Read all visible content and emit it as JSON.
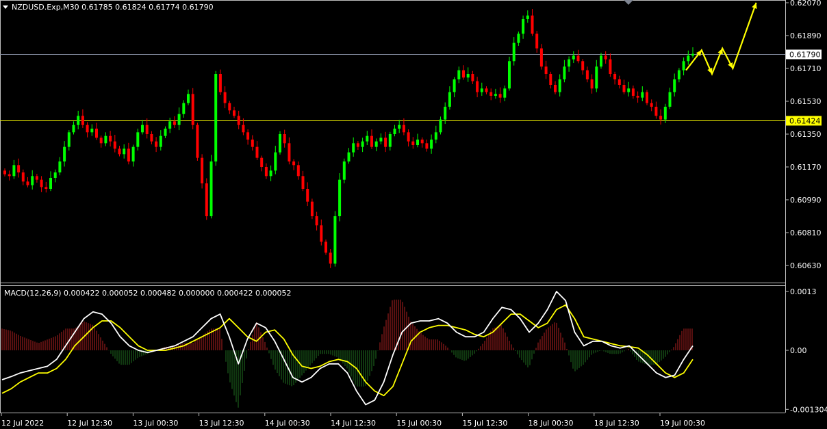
{
  "main_title": "NZDUSD.Exp,M30  0.61785 0.61824 0.61774 0.61790",
  "macd_title": "MACD(12,26,9) 0.000422 0.000052 0.000482 0.000000 0.000422 0.000052",
  "chart_data": [
    {
      "type": "candlestick",
      "symbol": "NZDUSD.Exp",
      "timeframe": "M30",
      "ohlc_last": {
        "open": 0.61785,
        "high": 0.61824,
        "low": 0.61774,
        "close": 0.6179
      },
      "ylim": [
        0.6054,
        0.6207
      ],
      "y_ticks": [
        {
          "value": 0.6207,
          "label": "0.62070"
        },
        {
          "value": 0.6189,
          "label": "0.61890"
        },
        {
          "value": 0.6171,
          "label": "0.61710"
        },
        {
          "value": 0.6153,
          "label": "0.61530"
        },
        {
          "value": 0.6135,
          "label": "0.61350"
        },
        {
          "value": 0.6117,
          "label": "0.61170"
        },
        {
          "value": 0.6099,
          "label": "0.60990"
        },
        {
          "value": 0.6081,
          "label": "0.60810"
        },
        {
          "value": 0.6063,
          "label": "0.60630"
        }
      ],
      "price_lines": [
        {
          "value": 0.6179,
          "label": "0.61790",
          "color": "#8a93a8",
          "label_bg": "#ffffff",
          "label_fg": "#000000"
        },
        {
          "value": 0.61424,
          "label": "0.61424",
          "color": "#e6e600",
          "label_bg": "#ffff00",
          "label_fg": "#000000"
        }
      ],
      "x_labels": [
        "12 Jul 2022",
        "12 Jul 12:30",
        "13 Jul 00:30",
        "13 Jul 12:30",
        "14 Jul 00:30",
        "14 Jul 12:30",
        "15 Jul 00:30",
        "15 Jul 12:30",
        "18 Jul 00:30",
        "18 Jul 12:30",
        "19 Jul 00:30"
      ],
      "bull_color": "#00ff00",
      "bear_color": "#ff0000",
      "closes": [
        0.6113,
        0.6112,
        0.6118,
        0.6114,
        0.6109,
        0.6107,
        0.6112,
        0.611,
        0.6106,
        0.6105,
        0.6111,
        0.6114,
        0.612,
        0.6128,
        0.6136,
        0.614,
        0.6145,
        0.614,
        0.6136,
        0.6138,
        0.6133,
        0.613,
        0.6134,
        0.6131,
        0.6127,
        0.6124,
        0.6127,
        0.612,
        0.6128,
        0.6136,
        0.614,
        0.6135,
        0.6131,
        0.6128,
        0.6134,
        0.6138,
        0.6142,
        0.614,
        0.6146,
        0.6152,
        0.6157,
        0.614,
        0.6122,
        0.6108,
        0.609,
        0.612,
        0.6168,
        0.6158,
        0.6152,
        0.6148,
        0.6145,
        0.614,
        0.6136,
        0.6132,
        0.6128,
        0.6122,
        0.6117,
        0.6112,
        0.6115,
        0.6125,
        0.6135,
        0.613,
        0.612,
        0.6118,
        0.6112,
        0.6105,
        0.6098,
        0.609,
        0.6085,
        0.6076,
        0.607,
        0.6064,
        0.609,
        0.611,
        0.612,
        0.6125,
        0.613,
        0.6128,
        0.6131,
        0.6134,
        0.6128,
        0.6131,
        0.6133,
        0.6128,
        0.6135,
        0.6138,
        0.614,
        0.6136,
        0.6131,
        0.6129,
        0.6132,
        0.613,
        0.6127,
        0.6132,
        0.6136,
        0.6143,
        0.615,
        0.6158,
        0.6165,
        0.617,
        0.6166,
        0.6168,
        0.6164,
        0.6158,
        0.616,
        0.6158,
        0.6156,
        0.6157,
        0.6155,
        0.616,
        0.6175,
        0.6185,
        0.619,
        0.6198,
        0.62,
        0.619,
        0.6182,
        0.6172,
        0.6168,
        0.6162,
        0.6158,
        0.6165,
        0.6172,
        0.6176,
        0.6178,
        0.6175,
        0.617,
        0.6165,
        0.616,
        0.6172,
        0.6178,
        0.6176,
        0.6168,
        0.6165,
        0.6162,
        0.6158,
        0.616,
        0.6156,
        0.6155,
        0.6158,
        0.6152,
        0.615,
        0.6145,
        0.6143,
        0.615,
        0.6158,
        0.6165,
        0.617,
        0.6175,
        0.6178,
        0.6179
      ],
      "arrows": {
        "color": "#ffff00",
        "path": [
          [
            0.617,
            0
          ],
          [
            0.6181,
            6
          ],
          [
            0.6168,
            10
          ],
          [
            0.6182,
            14
          ],
          [
            0.6171,
            18
          ],
          [
            0.6207,
            27
          ]
        ]
      }
    },
    {
      "type": "macd",
      "params": "MACD(12,26,9)",
      "ylim": [
        -0.0013,
        0.0013
      ],
      "y_ticks": [
        {
          "value": 0.0013,
          "label": "0.0013"
        },
        {
          "value": 0.0,
          "label": "0.00"
        },
        {
          "value": -0.001304,
          "label": "-0.001304"
        }
      ],
      "macd_line_color": "#ffffff",
      "signal_line_color": "#ffff00",
      "hist_pos_color": "#b02020",
      "hist_neg_color": "#207020",
      "macd": [
        -0.00065,
        -0.00058,
        -0.0005,
        -0.00045,
        -0.0004,
        -0.00035,
        -0.0002,
        0.0001,
        0.0004,
        0.0007,
        0.00085,
        0.0008,
        0.0006,
        0.0003,
        0.0001,
        0.0,
        -5e-05,
        0.0,
        5e-05,
        0.0001,
        0.0002,
        0.0003,
        0.0005,
        0.0007,
        0.0008,
        0.0003,
        -0.0003,
        0.00025,
        0.0006,
        0.0005,
        0.0002,
        -0.0002,
        -0.0006,
        -0.0007,
        -0.0006,
        -0.0004,
        -0.0003,
        -0.0003,
        -0.0005,
        -0.0009,
        -0.0012,
        -0.0011,
        -0.0007,
        -0.0001,
        0.0004,
        0.0006,
        0.00065,
        0.00065,
        0.0007,
        0.0006,
        0.0004,
        0.0003,
        0.0003,
        0.0004,
        0.0007,
        0.00095,
        0.0009,
        0.0007,
        0.0004,
        0.0006,
        0.0009,
        0.0013,
        0.0011,
        0.0004,
        0.0001,
        0.0002,
        0.0002,
        0.0001,
        5e-05,
        0.0001,
        -0.0001,
        -0.0003,
        -0.0005,
        -0.0006,
        -0.00055,
        -0.0002,
        0.0001
      ],
      "signal": [
        -0.00095,
        -0.00085,
        -0.0007,
        -0.0006,
        -0.0005,
        -0.0005,
        -0.0004,
        -0.0002,
        0.0001,
        0.0003,
        0.0005,
        0.00065,
        0.00065,
        0.0005,
        0.0003,
        0.0001,
        0.0,
        0.0,
        0.0,
        5e-05,
        0.0001,
        0.0002,
        0.0003,
        0.0004,
        0.0005,
        0.0007,
        0.0005,
        0.0003,
        0.0002,
        0.0004,
        0.00045,
        0.00025,
        -0.0001,
        -0.00035,
        -0.0004,
        -0.00035,
        -0.00025,
        -0.0002,
        -0.00025,
        -0.0004,
        -0.0007,
        -0.0009,
        -0.001,
        -0.0008,
        -0.0003,
        0.0002,
        0.0004,
        0.0005,
        0.00055,
        0.00055,
        0.0005,
        0.00045,
        0.00035,
        0.0003,
        0.0004,
        0.0006,
        0.0008,
        0.0008,
        0.00065,
        0.0005,
        0.0006,
        0.0009,
        0.001,
        0.0007,
        0.0003,
        0.00025,
        0.0002,
        0.00015,
        0.0001,
        8e-05,
        5e-05,
        -0.0001,
        -0.0003,
        -0.0005,
        -0.0006,
        -0.0005,
        -0.0002
      ]
    }
  ]
}
